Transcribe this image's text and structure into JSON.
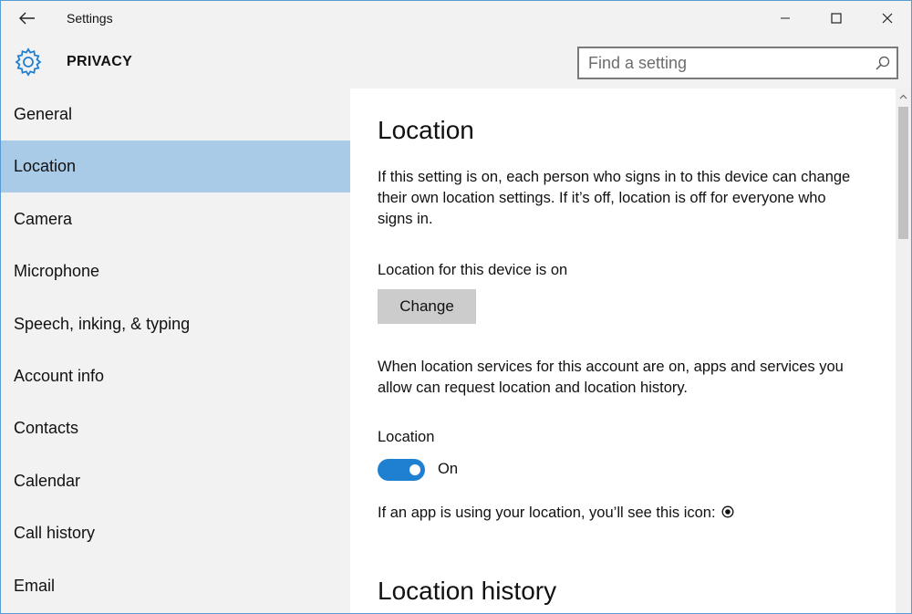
{
  "titlebar": {
    "app_title": "Settings",
    "back_icon": "back-arrow-icon",
    "minimize_icon": "minimize-icon",
    "maximize_icon": "maximize-icon",
    "close_icon": "close-icon"
  },
  "header": {
    "section_title": "PRIVACY",
    "section_icon": "gear-icon",
    "search": {
      "placeholder": "Find a setting",
      "value": "",
      "icon": "search-icon"
    }
  },
  "sidebar": {
    "items": [
      {
        "label": "General",
        "selected": false
      },
      {
        "label": "Location",
        "selected": true
      },
      {
        "label": "Camera",
        "selected": false
      },
      {
        "label": "Microphone",
        "selected": false
      },
      {
        "label": "Speech, inking, & typing",
        "selected": false
      },
      {
        "label": "Account info",
        "selected": false
      },
      {
        "label": "Contacts",
        "selected": false
      },
      {
        "label": "Calendar",
        "selected": false
      },
      {
        "label": "Call history",
        "selected": false
      },
      {
        "label": "Email",
        "selected": false
      }
    ],
    "selected_color": "#a9cbe8"
  },
  "main": {
    "title": "Location",
    "intro": "If this setting is on, each person who signs in to this device can change their own location settings. If it’s off, location is off for everyone who signs in.",
    "device_status": "Location for this device is on",
    "change_button": "Change",
    "services_text": "When location services for this account are on, apps and services you allow can request location and location history.",
    "toggle_title": "Location",
    "toggle_state": "On",
    "toggle_color": "#1f7fd1",
    "icon_note": "If an app is using your location, you’ll see this icon:",
    "icon_note_icon": "location-indicator-icon",
    "history_title": "Location history"
  }
}
